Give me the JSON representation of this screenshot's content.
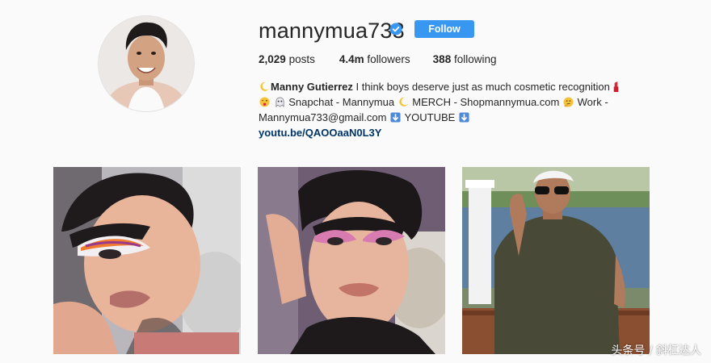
{
  "profile": {
    "username": "mannymua733",
    "follow_label": "Follow",
    "stats": {
      "posts_count": "2,029",
      "posts_label": "posts",
      "followers_count": "4.4m",
      "followers_label": "followers",
      "following_count": "388",
      "following_label": "following"
    },
    "bio": {
      "name": "Manny Gutierrez",
      "line1_text": "I think boys deserve just as much cosmetic recognition",
      "line2_snapchat": "Snapchat - Mannymua",
      "line2_merch": "MERCH - Shopmannymua.com",
      "line2_work": "Work -",
      "line3_email": "Mannymua733@gmail.com",
      "line3_youtube": "YOUTUBE",
      "link": "youtu.be/QAOOaaN0L3Y"
    }
  },
  "icons": [
    "verified-badge-icon",
    "moon-emoji-icon",
    "lipstick-emoji-icon",
    "wink-emoji-icon",
    "ghost-emoji-icon",
    "thinking-emoji-icon",
    "down-arrow-emoji-icon"
  ],
  "colors": {
    "accent": "#3897f0",
    "link": "#003569",
    "background": "#fafafa"
  },
  "watermark": "头条号 / 斜杠达人"
}
